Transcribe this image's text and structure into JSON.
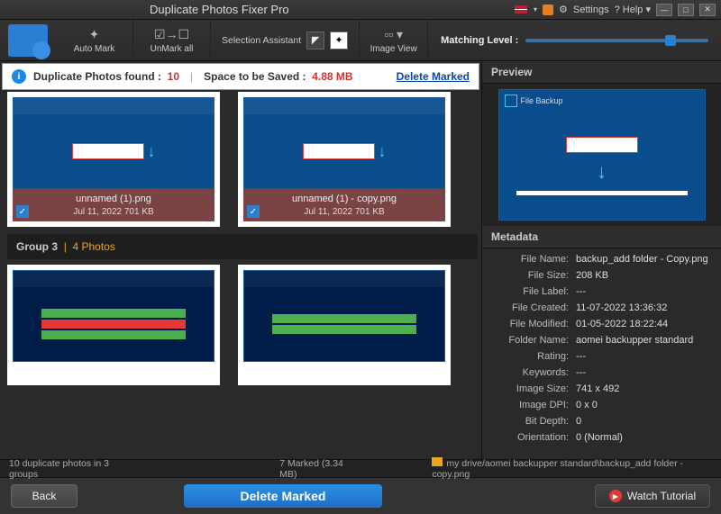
{
  "app": {
    "title": "Duplicate Photos Fixer Pro"
  },
  "titlebar": {
    "settings": "Settings",
    "help": "Help"
  },
  "toolbar": {
    "automark": "Auto Mark",
    "unmark": "UnMark all",
    "selassist": "Selection Assistant",
    "imgview": "Image View",
    "matchlevel": "Matching Level :"
  },
  "infobar": {
    "found_label": "Duplicate Photos found :",
    "found_count": "10",
    "space_label": "Space to be Saved :",
    "space_value": "4.88 MB",
    "delete_marked": "Delete Marked"
  },
  "thumbs": {
    "g2a": {
      "name": "unnamed (1).png",
      "meta": "Jul 11, 2022   701 KB"
    },
    "g2b": {
      "name": "unnamed (1) - copy.png",
      "meta": "Jul 11, 2022   701 KB"
    }
  },
  "group3": {
    "label": "Group 3",
    "sep": "|",
    "count": "4 Photos"
  },
  "right": {
    "preview": "Preview",
    "metadata": "Metadata"
  },
  "meta": {
    "filename_k": "File Name:",
    "filename_v": "backup_add folder - Copy.png",
    "filesize_k": "File Size:",
    "filesize_v": "208 KB",
    "filelabel_k": "File Label:",
    "filelabel_v": "---",
    "created_k": "File Created:",
    "created_v": "11-07-2022 13:36:32",
    "modified_k": "File Modified:",
    "modified_v": "01-05-2022 18:22:44",
    "folder_k": "Folder Name:",
    "folder_v": "aomei backupper standard",
    "rating_k": "Rating:",
    "rating_v": "---",
    "keywords_k": "Keywords:",
    "keywords_v": "---",
    "imgsize_k": "Image Size:",
    "imgsize_v": "741 x 492",
    "dpi_k": "Image DPI:",
    "dpi_v": "0 x 0",
    "bitdepth_k": "Bit Depth:",
    "bitdepth_v": "0",
    "orient_k": "Orientation:",
    "orient_v": "0 (Normal)"
  },
  "status": {
    "summary": "10 duplicate photos in 3 groups",
    "marked": "7 Marked (3.34 MB)",
    "path": "my drive/aomei backupper standard\\backup_add folder - copy.png"
  },
  "footer": {
    "back": "Back",
    "delete": "Delete Marked",
    "watch": "Watch Tutorial"
  }
}
